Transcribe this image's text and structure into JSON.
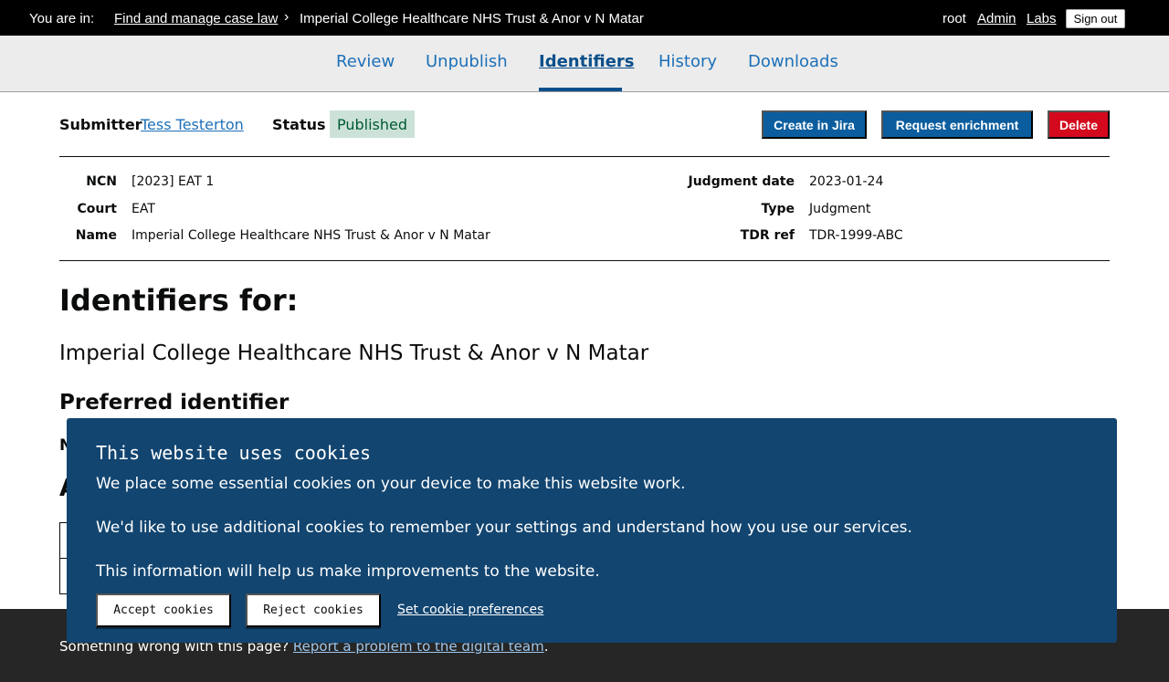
{
  "topbar": {
    "you_are_in": "You are in:",
    "breadcrumb_link": "Find and manage case law",
    "breadcrumb_current": "Imperial College Healthcare NHS Trust & Anor v N Matar",
    "user": "root",
    "admin": "Admin",
    "labs": "Labs",
    "sign_out": "Sign out"
  },
  "tabs": [
    {
      "label": "Review"
    },
    {
      "label": "Unpublish"
    },
    {
      "label": "Identifiers",
      "active": true
    },
    {
      "label": "History"
    },
    {
      "label": "Downloads"
    }
  ],
  "submission": {
    "submitter_label": "Submitter",
    "submitter_name": "Tess Testerton",
    "status_label": "Status",
    "status_value": "Published",
    "create_jira": "Create in Jira",
    "request_enrichment": "Request enrichment",
    "delete": "Delete"
  },
  "meta": {
    "ncn_label": "NCN",
    "ncn": "[2023] EAT 1",
    "court_label": "Court",
    "court": "EAT",
    "name_label": "Name",
    "name": "Imperial College Healthcare NHS Trust & Anor v N Matar",
    "date_label": "Judgment date",
    "date": "2023-01-24",
    "type_label": "Type",
    "type": "Judgment",
    "tdr_label": "TDR ref",
    "tdr": "TDR-1999-ABC"
  },
  "main": {
    "heading": "Identifiers for:",
    "case_name": "Imperial College Healthcare NHS Trust & Anor v N Matar",
    "preferred_heading": "Preferred identifier",
    "obscured_line1": "N",
    "obscured_heading2": "A"
  },
  "cookie": {
    "title": "This website uses cookies",
    "p1": "We place some essential cookies on your device to make this website work.",
    "p2": "We'd like to use additional cookies to remember your settings and understand how you use our services.",
    "p3": "This information will help us make improvements to the website.",
    "accept": "Accept cookies",
    "reject": "Reject cookies",
    "preferences": "Set cookie preferences"
  },
  "footer": {
    "text": "Something wrong with this page?",
    "link": "Report a problem to the digital team",
    "end": "."
  }
}
